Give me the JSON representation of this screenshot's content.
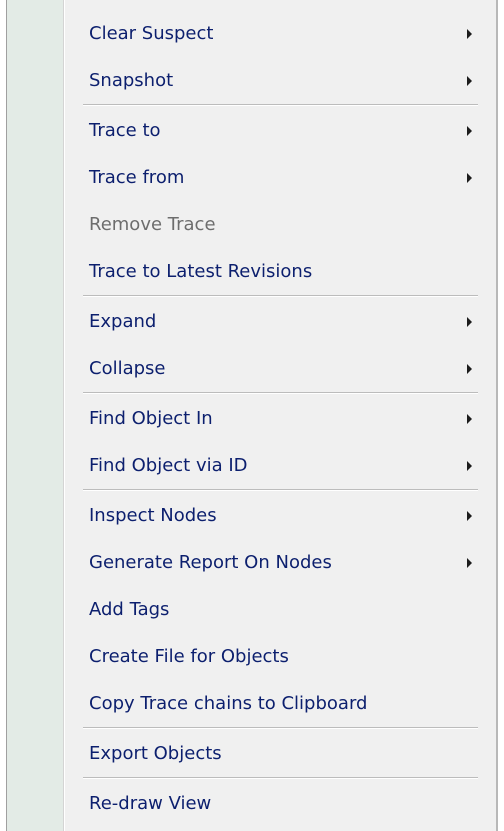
{
  "menu": {
    "clear_suspect": "Clear Suspect",
    "snapshot": "Snapshot",
    "trace_to": "Trace to",
    "trace_from": "Trace from",
    "remove_trace": "Remove Trace",
    "trace_to_latest_revisions": "Trace to Latest Revisions",
    "expand": "Expand",
    "collapse": "Collapse",
    "find_object_in": "Find Object In",
    "find_object_via_id": "Find Object via ID",
    "inspect_nodes": "Inspect Nodes",
    "generate_report_on_nodes": "Generate Report On Nodes",
    "add_tags": "Add Tags",
    "create_file_for_objects": "Create File for Objects",
    "copy_trace_chains": "Copy Trace chains to Clipboard",
    "export_objects": "Export Objects",
    "redraw_view": "Re-draw View"
  },
  "icons": {
    "submenu": "chevron-right-icon"
  },
  "colors": {
    "text": "#0c1f6e",
    "disabled_text": "#6d6d6d",
    "background": "#f0f0f0",
    "gutter": "#e3ebe6"
  }
}
